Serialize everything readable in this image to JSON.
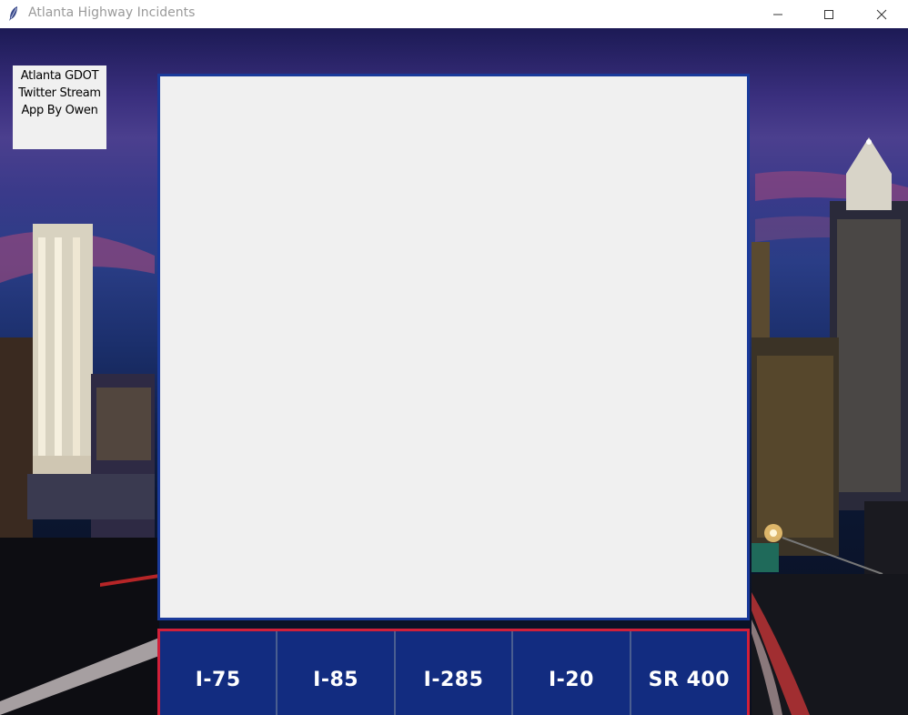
{
  "window": {
    "title": "Atlanta Highway Incidents",
    "minimize_icon": "minimize-icon",
    "maximize_icon": "maximize-icon",
    "close_icon": "close-icon"
  },
  "credit": {
    "line1": "Atlanta GDOT",
    "line2": "Twitter Stream",
    "line3": "App By Owen"
  },
  "feed": {
    "text": ""
  },
  "highways": [
    {
      "label": "I-75"
    },
    {
      "label": "I-85"
    },
    {
      "label": "I-285"
    },
    {
      "label": "I-20"
    },
    {
      "label": "SR 400"
    }
  ],
  "colors": {
    "button_bg": "#122c80",
    "button_bar_border": "#d0203a",
    "feed_border": "#1a3a9a",
    "feed_bg": "#f0f0f0"
  }
}
